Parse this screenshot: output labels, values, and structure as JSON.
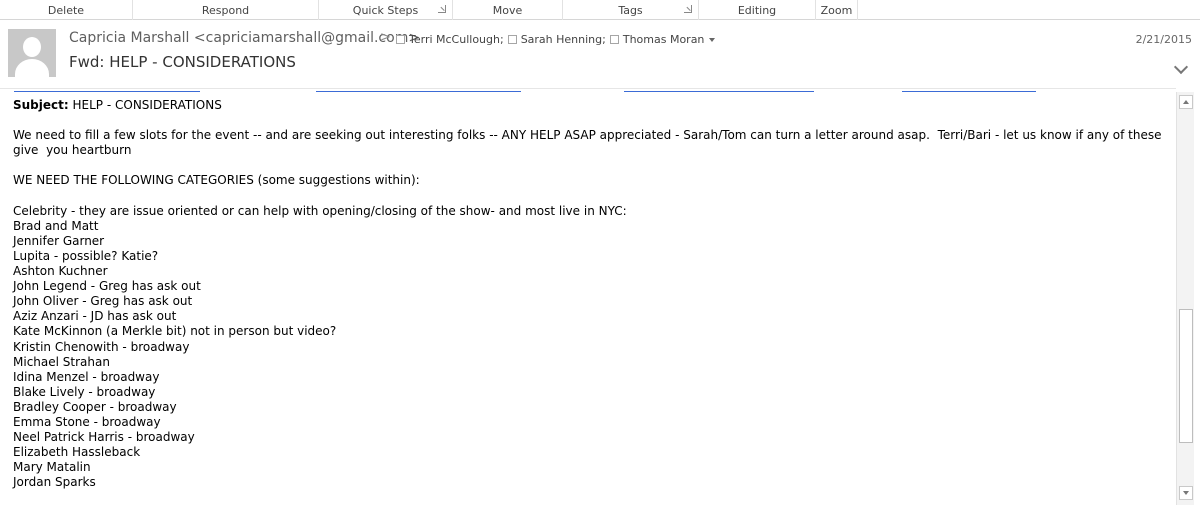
{
  "ribbon": {
    "groups": [
      {
        "label": "Delete"
      },
      {
        "label": "Respond"
      },
      {
        "label": "Quick Steps"
      },
      {
        "label": "Move"
      },
      {
        "label": "Tags"
      },
      {
        "label": "Editing"
      },
      {
        "label": "Zoom"
      }
    ]
  },
  "header": {
    "sender": "Capricia Marshall <capriciamarshall@gmail.com>",
    "sender_separator": ">",
    "recipients": [
      "Terri McCullough;",
      "Sarah Henning;",
      "Thomas Moran"
    ],
    "date": "2/21/2015",
    "subject": "Fwd: HELP - CONSIDERATIONS"
  },
  "body": {
    "subject_label": "Subject:",
    "subject_value": " HELP - CONSIDERATIONS",
    "paragraph1": "We need to fill a few slots for the event -- and are seeking out interesting folks -- ANY HELP ASAP appreciated - Sarah/Tom can turn a letter around asap.  Terri/Bari - let us know if any of these give  you heartburn",
    "categories_heading": "WE NEED THE FOLLOWING CATEGORIES (some suggestions within):",
    "celebrity_intro": "Celebrity - they are issue oriented or can help with opening/closing of the show- and most live in NYC:",
    "names": [
      "Brad and Matt",
      "Jennifer Garner",
      "Lupita - possible? Katie?",
      "Ashton Kuchner",
      "John Legend - Greg has ask out",
      "John Oliver - Greg has ask out",
      "Aziz Anzari - JD has ask out",
      "Kate McKinnon (a Merkle bit) not in person but video?",
      "Kristin Chenowith - broadway",
      "Michael Strahan",
      "Idina Menzel - broadway",
      "Blake Lively - broadway",
      "Bradley Cooper - broadway",
      "Emma Stone - broadway",
      "Neel Patrick Harris - broadway",
      "Elizabeth Hassleback",
      "Mary Matalin",
      "Jordan Sparks"
    ]
  },
  "icons": {
    "avatar": "person-silhouette-icon",
    "expand": "chevron-down-icon",
    "scroll_up": "arrow-up-icon",
    "scroll_down": "arrow-down-icon"
  },
  "colors": {
    "link": "#3b6bd6",
    "avatar_bg": "#c8c8c8"
  }
}
